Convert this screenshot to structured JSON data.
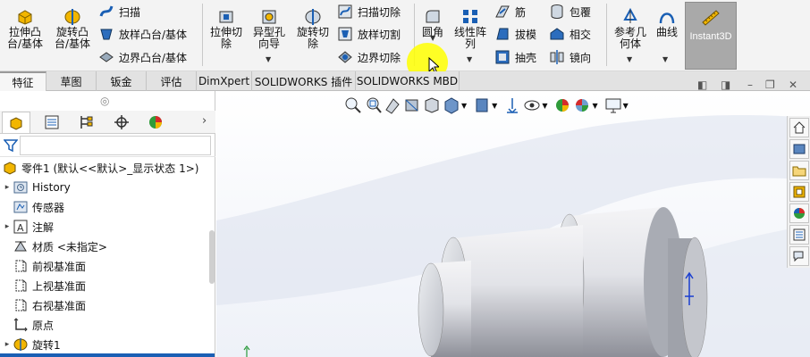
{
  "ribbon": {
    "extrude_boss": "拉伸凸\n台/基体",
    "revolve_boss": "旋转凸\n台/基体",
    "sweep": "扫描",
    "loft_boss": "放样凸台/基体",
    "boundary_boss": "边界凸台/基体",
    "extrude_cut": "拉伸切\n除",
    "hole_wizard": "异型孔\n向导",
    "revolve_cut": "旋转切\n除",
    "swept_cut": "扫描切除",
    "lofted_cut": "放样切割",
    "boundary_cut": "边界切除",
    "fillet": "圆角",
    "linear_pattern": "线性阵\n列",
    "rib": "筋",
    "draft": "拔模",
    "shell": "抽壳",
    "wrap": "包覆",
    "intersect": "相交",
    "mirror": "镜向",
    "reference_geometry": "参考几\n何体",
    "curves": "曲线",
    "instant3d": "Instant3D"
  },
  "tabs": [
    {
      "label": "特征",
      "active": true
    },
    {
      "label": "草图",
      "active": false
    },
    {
      "label": "钣金",
      "active": false
    },
    {
      "label": "评估",
      "active": false
    },
    {
      "label": "DimXpert",
      "active": false
    },
    {
      "label": "SOLIDWORKS 插件",
      "active": false
    },
    {
      "label": "SOLIDWORKS MBD",
      "active": false
    }
  ],
  "tree": {
    "root": "零件1 (默认<<默认>_显示状态 1>)",
    "items": [
      {
        "label": "History",
        "icon": "history-folder-icon"
      },
      {
        "label": "传感器",
        "icon": "sensor-icon"
      },
      {
        "label": "注解",
        "icon": "annotation-icon"
      },
      {
        "label": "材质 <未指定>",
        "icon": "material-icon"
      },
      {
        "label": "前视基准面",
        "icon": "plane-icon"
      },
      {
        "label": "上视基准面",
        "icon": "plane-icon"
      },
      {
        "label": "右视基准面",
        "icon": "plane-icon"
      },
      {
        "label": "原点",
        "icon": "origin-icon"
      },
      {
        "label": "旋转1",
        "icon": "revolve-feature-icon"
      }
    ]
  },
  "colors": {
    "accent_blue": "#1a5fb4",
    "icon_yellow": "#f2b600",
    "highlight": "#ffff00",
    "instant3d_bg": "#a9a9a9"
  }
}
